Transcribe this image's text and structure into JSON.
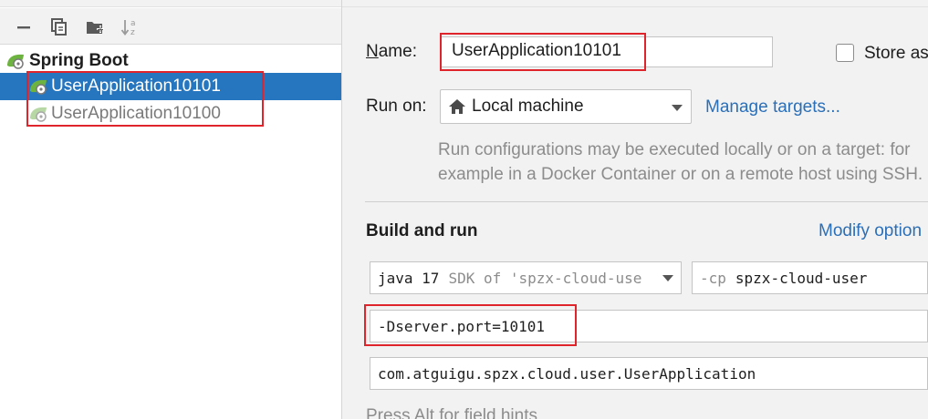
{
  "colors": {
    "selection": "#2675bf",
    "link": "#2a6fb8",
    "highlight_box": "#e0242b",
    "spring_green": "#6db33f"
  },
  "toolbar": {
    "icons": [
      "remove-icon",
      "copy-icon",
      "new-folder-icon",
      "sort-alphabetical-icon"
    ]
  },
  "tree": {
    "group_label": "Spring Boot",
    "items": [
      {
        "label": "UserApplication10101",
        "selected": true
      },
      {
        "label": "UserApplication10100",
        "selected": false
      }
    ]
  },
  "form": {
    "name_label": "Name:",
    "name_value": "UserApplication10101",
    "store_as_label": "Store as",
    "run_on_label": "Run on:",
    "run_on_value": "Local machine",
    "manage_targets_link": "Manage targets...",
    "run_on_hint_line1": "Run configurations may be executed locally or on a target: for",
    "run_on_hint_line2": "example in a Docker Container or on a remote host using SSH.",
    "build_and_run_title": "Build and run",
    "modify_options_link": "Modify option",
    "sdk_java": "java 17",
    "sdk_detail": "SDK of 'spzx-cloud-use",
    "cp_flag": "-cp",
    "cp_value": "spzx-cloud-user",
    "vm_options_value": "-Dserver.port=10101",
    "main_class_value": "com.atguigu.spzx.cloud.user.UserApplication",
    "field_hints_text": "Press Alt for field hints"
  }
}
